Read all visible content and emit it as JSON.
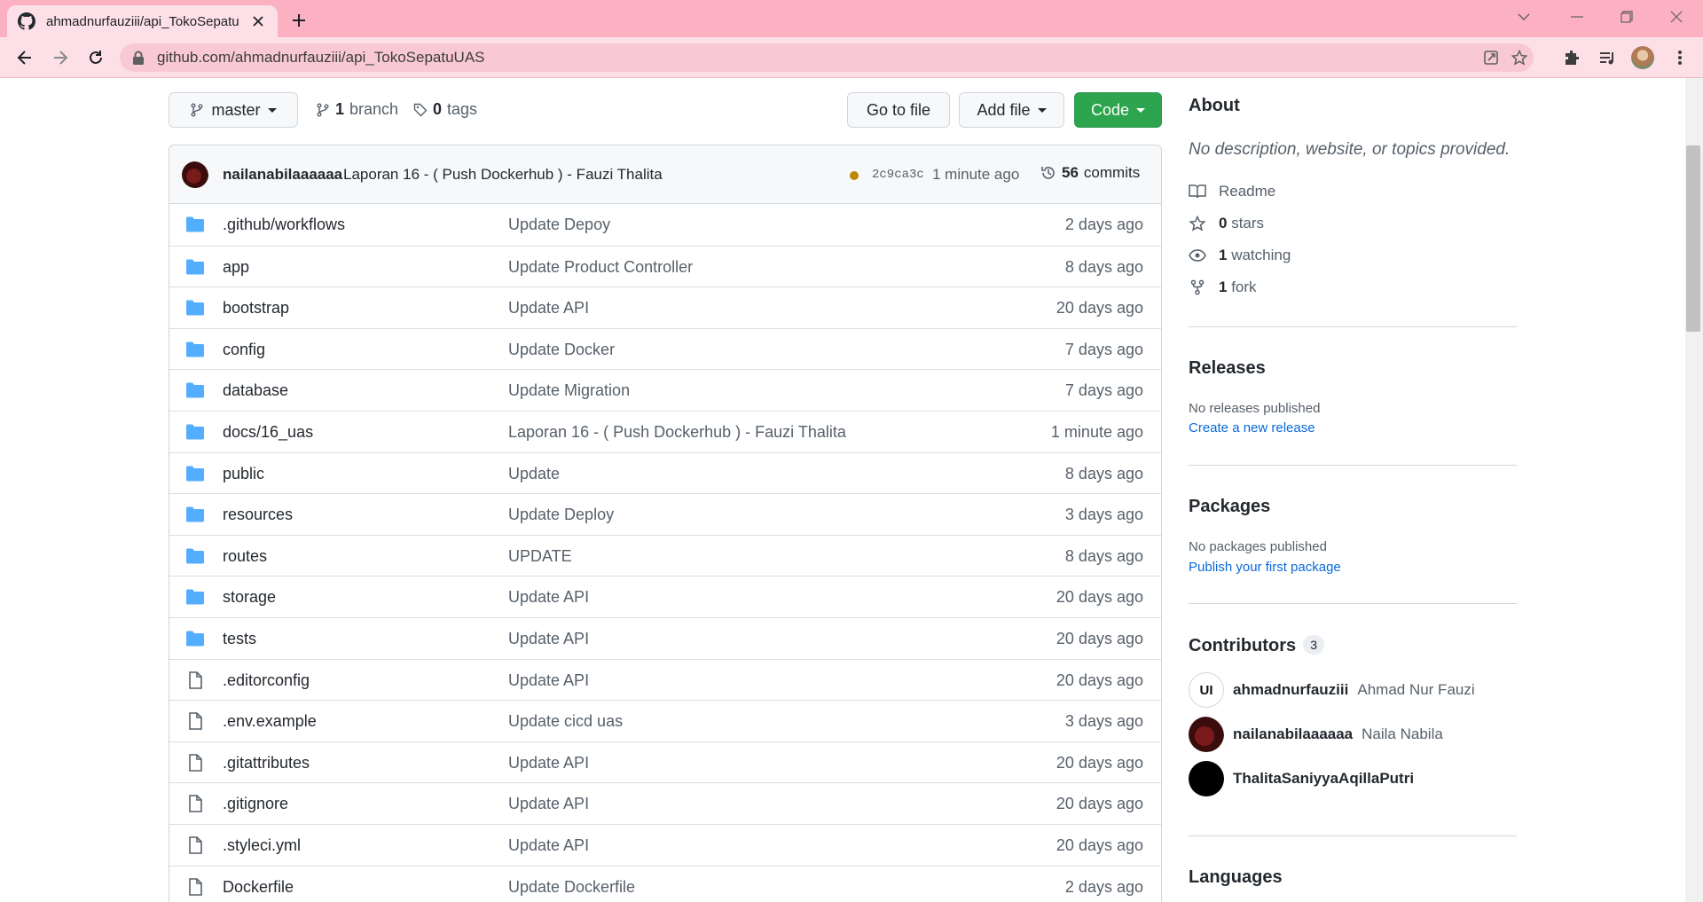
{
  "browser": {
    "tab_title": "ahmadnurfauziii/api_TokoSepatu",
    "url": "github.com/ahmadnurfauziii/api_TokoSepatuUAS",
    "accent": "#fcb1c3"
  },
  "repo_toolbar": {
    "branch_selector": "master",
    "branches_count": "1",
    "branches_label": "branch",
    "tags_count": "0",
    "tags_label": "tags",
    "go_to_file": "Go to file",
    "add_file": "Add file",
    "code": "Code"
  },
  "latest_commit": {
    "author": "nailanabilaaaaaa",
    "message": "Laporan 16 - ( Push Dockerhub ) - Fauzi Thalita",
    "sha": "2c9ca3c",
    "time": "1 minute ago",
    "commits_count": "56",
    "commits_label": "commits"
  },
  "files": [
    {
      "type": "dir",
      "name": ".github/workflows",
      "message": "Update Depoy",
      "age": "2 days ago"
    },
    {
      "type": "dir",
      "name": "app",
      "message": "Update Product Controller",
      "age": "8 days ago"
    },
    {
      "type": "dir",
      "name": "bootstrap",
      "message": "Update API",
      "age": "20 days ago"
    },
    {
      "type": "dir",
      "name": "config",
      "message": "Update Docker",
      "age": "7 days ago"
    },
    {
      "type": "dir",
      "name": "database",
      "message": "Update Migration",
      "age": "7 days ago"
    },
    {
      "type": "dir",
      "name": "docs/16_uas",
      "message": "Laporan 16 - ( Push Dockerhub ) - Fauzi Thalita",
      "age": "1 minute ago"
    },
    {
      "type": "dir",
      "name": "public",
      "message": "Update",
      "age": "8 days ago"
    },
    {
      "type": "dir",
      "name": "resources",
      "message": "Update Deploy",
      "age": "3 days ago"
    },
    {
      "type": "dir",
      "name": "routes",
      "message": "UPDATE",
      "age": "8 days ago"
    },
    {
      "type": "dir",
      "name": "storage",
      "message": "Update API",
      "age": "20 days ago"
    },
    {
      "type": "dir",
      "name": "tests",
      "message": "Update API",
      "age": "20 days ago"
    },
    {
      "type": "file",
      "name": ".editorconfig",
      "message": "Update API",
      "age": "20 days ago"
    },
    {
      "type": "file",
      "name": ".env.example",
      "message": "Update cicd uas",
      "age": "3 days ago"
    },
    {
      "type": "file",
      "name": ".gitattributes",
      "message": "Update API",
      "age": "20 days ago"
    },
    {
      "type": "file",
      "name": ".gitignore",
      "message": "Update API",
      "age": "20 days ago"
    },
    {
      "type": "file",
      "name": ".styleci.yml",
      "message": "Update API",
      "age": "20 days ago"
    },
    {
      "type": "file",
      "name": "Dockerfile",
      "message": "Update Dockerfile",
      "age": "2 days ago"
    }
  ],
  "sidebar": {
    "about_title": "About",
    "about_description": "No description, website, or topics provided.",
    "readme": "Readme",
    "stars_count": "0",
    "stars_label": "stars",
    "watching_count": "1",
    "watching_label": "watching",
    "forks_count": "1",
    "forks_label": "fork",
    "releases_title": "Releases",
    "releases_empty": "No releases published",
    "releases_link": "Create a new release",
    "packages_title": "Packages",
    "packages_empty": "No packages published",
    "packages_link": "Publish your first package",
    "contributors_title": "Contributors",
    "contributors_count": "3",
    "contributors": [
      {
        "login": "ahmadnurfauziii",
        "name": "Ahmad Nur Fauzi",
        "avatar_text": "UI"
      },
      {
        "login": "nailanabilaaaaaa",
        "name": "Naila Nabila",
        "avatar_text": ""
      },
      {
        "login": "ThalitaSaniyyaAqillaPutri",
        "name": "",
        "avatar_text": ""
      }
    ],
    "languages_title": "Languages"
  }
}
